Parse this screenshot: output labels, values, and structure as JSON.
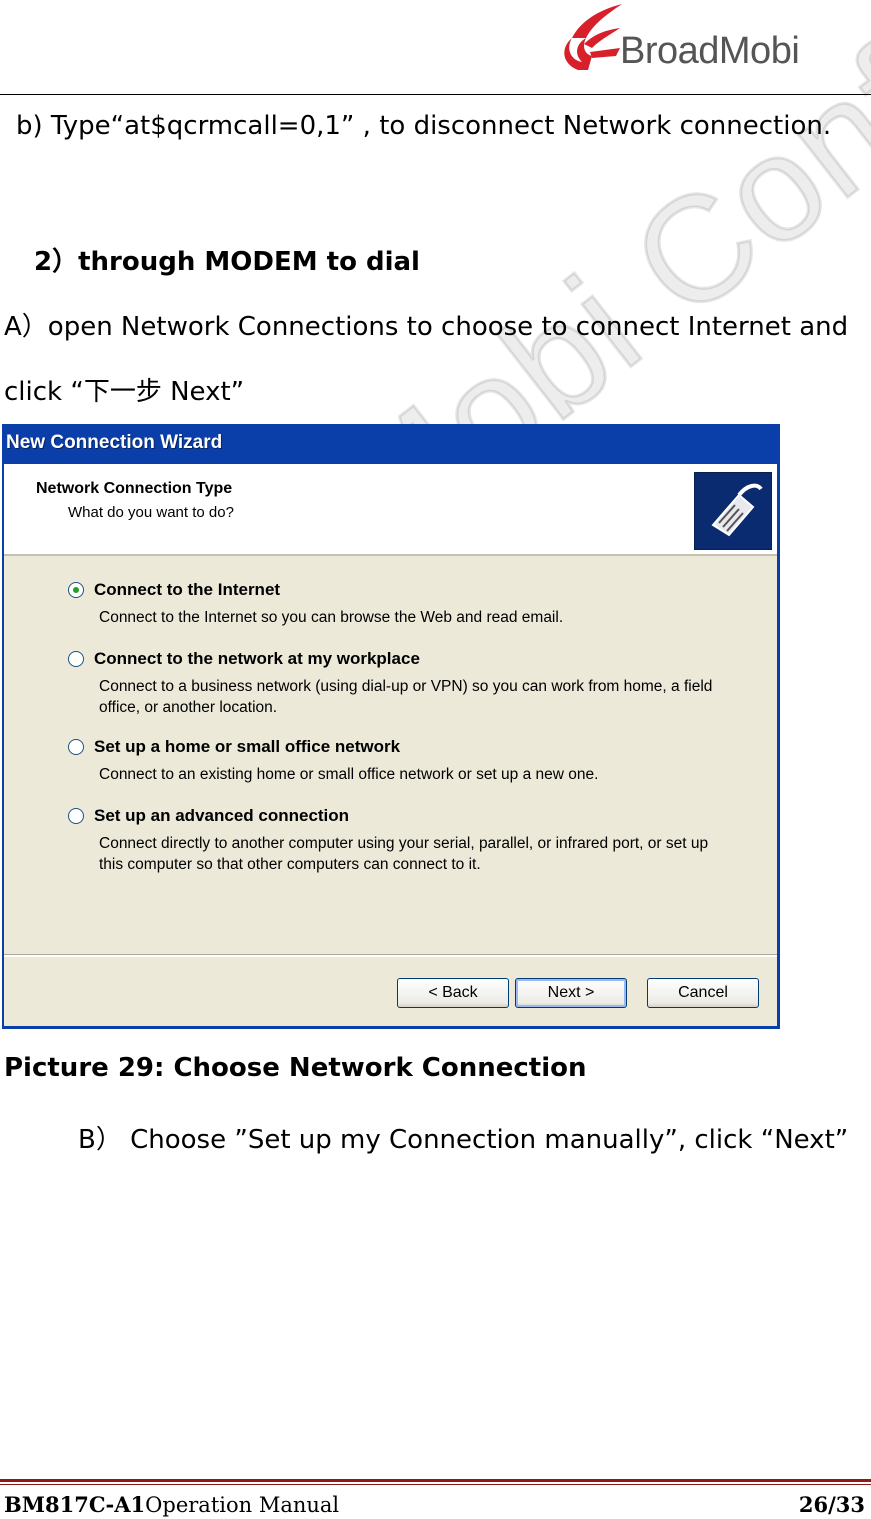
{
  "header": {
    "logo_text": "BroadMobi"
  },
  "watermark": "BroadMobi Confidential",
  "body": {
    "step_b": "b)   Type“at$qcrmcall=0,1” , to disconnect Network connection.",
    "section_title": "2）through MODEM to dial",
    "step_a_line1": "A）open Network Connections to choose to connect Internet and",
    "step_a_line2": "click “下一步  Next”",
    "caption": "Picture 29: Choose Network Connection",
    "step_b2": "B）    Choose ”Set up my Connection manually”, click   “Next”"
  },
  "wizard": {
    "title": "New Connection Wizard",
    "heading": "Network Connection Type",
    "subheading": "What do you want to do?",
    "options": [
      {
        "label": "Connect to the Internet",
        "desc": "Connect to the Internet so you can browse the Web and read email.",
        "selected": true
      },
      {
        "label": "Connect to the network at my workplace",
        "desc": "Connect to a business network (using dial-up or VPN) so you can work from home, a field office, or another location.",
        "selected": false
      },
      {
        "label": "Set up a home or small office network",
        "desc": "Connect to an existing home or small office network or set up a new one.",
        "selected": false
      },
      {
        "label": "Set up an advanced connection",
        "desc": "Connect directly to another computer using your serial, parallel, or infrared port, or set up this computer so that other computers can connect to it.",
        "selected": false
      }
    ],
    "back_label": "< Back",
    "next_label": "Next >",
    "cancel_label": "Cancel"
  },
  "footer": {
    "model": "BM817C-A1",
    "manual": "Operation Manual",
    "page": "26/33"
  },
  "colors": {
    "title_bar": "#0a3ea8",
    "dialog_bg": "#ece9d8",
    "footer_rule": "#8b1a1a",
    "logo_red": "#d8202a"
  }
}
